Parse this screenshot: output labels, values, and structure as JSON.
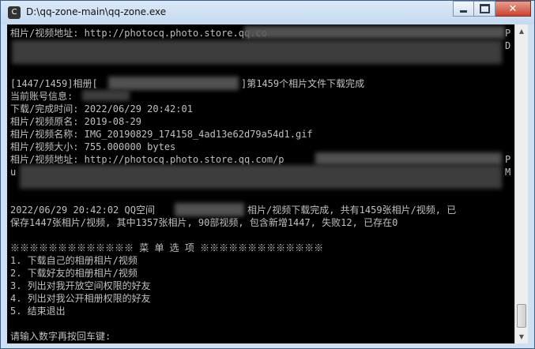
{
  "window": {
    "title": "D:\\qq-zone-main\\qq-zone.exe",
    "icon": "console-app-icon",
    "controls": {
      "minimize": "minimize-icon",
      "maximize": "maximize-icon",
      "close": "close-icon",
      "close_glyph": "✕"
    }
  },
  "console": {
    "lines": [
      "相片/视频地址: http://photocq.photo.store.qq.co",
      "",
      "",
      "",
      "[1447/1459]相册[",
      "当前账号信息:",
      "下载/完成时间: 2022/06/29 20:42:01",
      "相片/视频原名: 2019-08-29",
      "相片/视频名称: IMG_20190829_174158_4ad13e62d79a54d1.gif",
      "相片/视频大小: 755.000000 bytes",
      "相片/视频地址: http://photocq.photo.store.qq.com/p",
      "",
      "",
      "",
      "2022/06/29 20:42:02 QQ空间",
      "保存1447张相片/视频, 其中1357张相片, 90部视频, 包含新增1447, 失败12, 已存在0",
      "",
      "※※※※※※※※※※※※※ 菜 单 选 项 ※※※※※※※※※※※※※",
      "1. 下载自己的相册相片/视频",
      "2. 下载好友的相册相片/视频",
      "3. 列出对我开放空间权限的好友",
      "4. 列出对我公开相册权限的好友",
      "5. 结束退出",
      "",
      "请输入数字再按回车键:"
    ],
    "fragments": {
      "album_done": "]第1459个相片文件下载完成",
      "summary_tail": "相片/视频下载完成, 共有1459张相片/视频, 已",
      "url_edge_p1": "P",
      "url_edge_d": "D",
      "url_edge_p2": "P",
      "url_edge_u": "u",
      "url_edge_m": "M"
    }
  },
  "scrollbar": {
    "up_arrow": "▲",
    "down_arrow": "▼"
  }
}
